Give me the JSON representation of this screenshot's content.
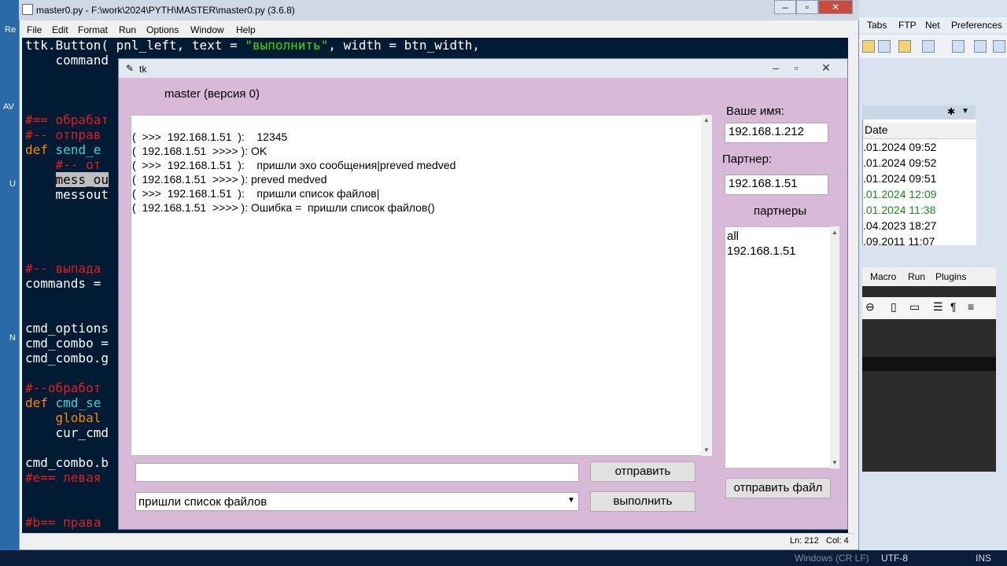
{
  "desktop": {
    "left_letters": [
      "Re",
      "AV",
      "U",
      "N"
    ]
  },
  "background_app": {
    "menu": [
      "Tabs",
      "FTP",
      "Net",
      "Preferences"
    ],
    "list_header": "Date",
    "rows": [
      {
        "text": ".01.2024 09:52",
        "color": "#000000"
      },
      {
        "text": ".01.2024 09:52",
        "color": "#000000"
      },
      {
        "text": ".01.2024 09:51",
        "color": "#000000"
      },
      {
        "text": ".01.2024 12:09",
        "color": "#1a8a1a"
      },
      {
        "text": ".01.2024 11:38",
        "color": "#1a8a1a"
      },
      {
        "text": ".04.2023 18:27",
        "color": "#000000"
      },
      {
        "text": ".09.2011 11:07",
        "color": "#000000"
      }
    ],
    "lower_menu": [
      "Macro",
      "Run",
      "Plugins"
    ]
  },
  "editor": {
    "title": "master0.py - F:\\work\\2024\\PYTH\\MASTER\\master0.py (3.6.8)",
    "menu": [
      "File",
      "Edit",
      "Format",
      "Run",
      "Options",
      "Window",
      "Help"
    ],
    "status_ln": "Ln: 212",
    "status_col": "Col: 4"
  },
  "taskbar": {
    "encoding": "UTF-8",
    "mode": "INS",
    "eol": "Windows (CR LF)"
  },
  "tk": {
    "title": "tk",
    "header": "master (версия 0)",
    "name_label": "Ваше имя:",
    "name_value": "192.168.1.212",
    "partner_label": "Партнер:",
    "partner_value": "192.168.1.51",
    "partners_label": "партнеры",
    "partners": [
      "all",
      "192.168.1.51"
    ],
    "log": [
      "(  >>>  192.168.1.51  ):    12345",
      "(  192.168.1.51  >>>> ): OK",
      "(  >>>  192.168.1.51  ):    пришли эхо сообщения|preved medved",
      "(  192.168.1.51  >>>> ): preved medved",
      "(  >>>  192.168.1.51  ):    пришли список файлов|",
      "(  192.168.1.51  >>>> ): Ошибка =  пришли список файлов()"
    ],
    "message_input": "",
    "send_button": "отправить",
    "command_combo": "пришли список файлов",
    "execute_button": "выполнить",
    "send_file_button": "отправить файл"
  }
}
